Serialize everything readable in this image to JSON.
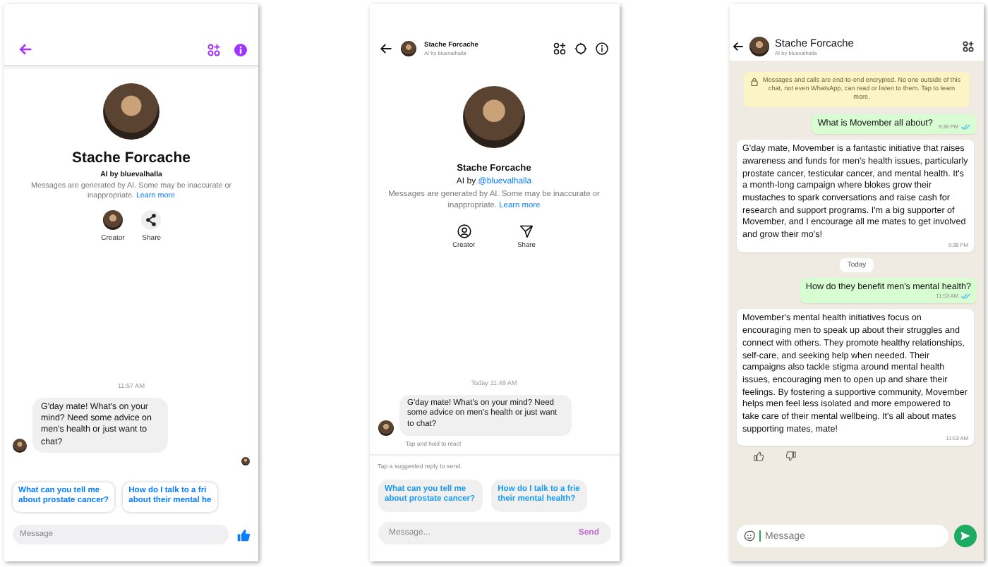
{
  "messenger": {
    "name": "Stache Forcache",
    "subtitle": "AI by bluevalhalla",
    "disclaimer": "Messages are generated by AI. Some may be inaccurate or inappropriate.",
    "learn_more": "Learn more",
    "actions": [
      "Creator",
      "Share"
    ],
    "time": "11:57 AM",
    "message": "G'day mate! What's on your mind? Need some advice on men's health or just want to chat?",
    "suggestions": [
      {
        "lines": [
          "What can you tell me",
          "about prostate cancer?"
        ]
      },
      {
        "lines": [
          "How do I talk to a fri",
          "about their mental he"
        ]
      }
    ],
    "placeholder": "Message"
  },
  "instagram": {
    "header_name": "Stache Forcache",
    "header_subtitle": "AI by bluevalhalla",
    "name": "Stache Forcache",
    "by_prefix": "AI by",
    "by_link": "@bluevalhalla",
    "disclaimer": "Messages are generated by AI. Some may be inaccurate or inappropriate.",
    "learn_more": "Learn more",
    "actions": [
      "Creator",
      "Share"
    ],
    "time": "Today 11:49 AM",
    "message": "G'day mate! What's on your mind? Need some advice on men's health or just want to chat?",
    "react_hint": "Tap and hold to react",
    "suggest_hint": "Tap a suggested reply to send.",
    "suggestions": [
      {
        "lines": [
          "What can you tell me",
          "about prostate cancer?"
        ]
      },
      {
        "lines": [
          "How do I talk to a frie",
          "their mental health?"
        ]
      }
    ],
    "placeholder": "Message...",
    "send": {
      "label": "Send",
      "disabled": true
    }
  },
  "whatsapp": {
    "name": "Stache Forcache",
    "subtitle": "AI by bluevalhalla",
    "notice": "Messages and calls are end-to-end encrypted. No one outside of this chat, not even WhatsApp, can read or listen to them. Tap to learn more.",
    "messages": [
      {
        "kind": "outgoing",
        "text": "What is Movember all about?",
        "time": "9:38 PM",
        "read": true
      },
      {
        "kind": "incoming",
        "text": "G'day mate, Movember is a fantastic initiative that raises awareness and funds for men's health issues, particularly prostate cancer, testicular cancer, and mental health. It's a month-long campaign where blokes grow their mustaches to spark conversations and raise cash for research and support programs. I'm a big supporter of Movember, and I encourage all me mates to get involved and grow their mo's!",
        "time": "9:38 PM"
      },
      {
        "kind": "date",
        "text": "Today"
      },
      {
        "kind": "outgoing",
        "text": "How do they benefit men's mental health?",
        "time": "11:53 AM",
        "read": true
      },
      {
        "kind": "incoming",
        "text": "Movember's mental health initiatives focus on encouraging men to speak up about their struggles and connect with others. They promote healthy relationships, self-care, and seeking help when needed. Their campaigns also tackle stigma around mental health issues, encouraging men to open up and share their feelings. By fostering a supportive community, Movember helps men feel less isolated and more empowered to take care of their mental wellbeing. It's all about mates supporting mates, mate!",
        "time": "11:53 AM"
      }
    ],
    "placeholder": "Message"
  }
}
